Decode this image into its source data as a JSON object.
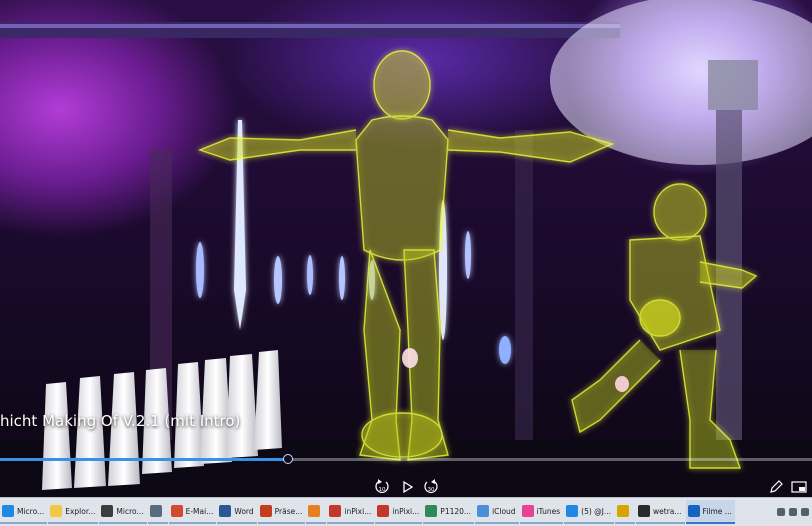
{
  "video": {
    "title": "hicht Making Of V.2.1 (mit Intro)",
    "progress": 0.355,
    "controls": {
      "rewind_label": "10",
      "forward_label": "30"
    }
  },
  "taskbar": {
    "items": [
      {
        "label": "Micro...",
        "color": "#1e88e5"
      },
      {
        "label": "Explor...",
        "color": "#f2c744"
      },
      {
        "label": "Micro...",
        "color": "#3c3c3c"
      },
      {
        "label": "",
        "color": "#5a6a80"
      },
      {
        "label": "E-Mai...",
        "color": "#d04a2f"
      },
      {
        "label": "Word",
        "color": "#2b5797"
      },
      {
        "label": "Präse...",
        "color": "#c43e1c"
      },
      {
        "label": "",
        "color": "#e67e22"
      },
      {
        "label": "inPixi...",
        "color": "#c0392b"
      },
      {
        "label": "inPixi...",
        "color": "#c0392b"
      },
      {
        "label": "P1120...",
        "color": "#2e8b57"
      },
      {
        "label": "iCloud",
        "color": "#4a90d9"
      },
      {
        "label": "iTunes",
        "color": "#e84393"
      },
      {
        "label": "(5) @J...",
        "color": "#1e88e5"
      },
      {
        "label": "",
        "color": "#d8a400"
      },
      {
        "label": "wetra...",
        "color": "#2a2a2a"
      },
      {
        "label": "Filme ...",
        "color": "#1565c0",
        "active": true
      }
    ]
  }
}
